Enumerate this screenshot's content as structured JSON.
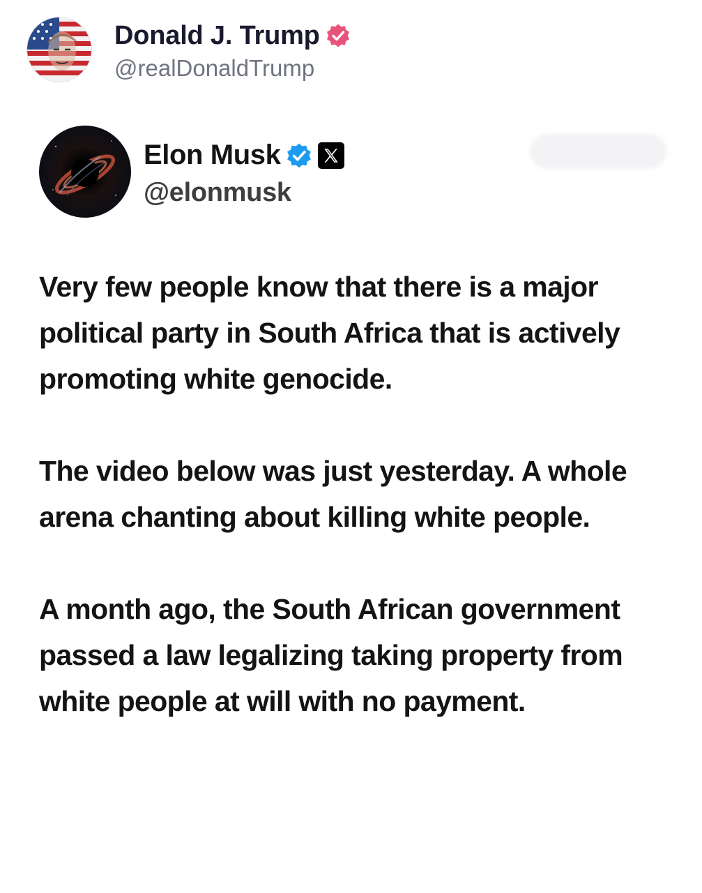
{
  "outer_post": {
    "display_name": "Donald J. Trump",
    "handle": "@realDonaldTrump",
    "verified_icon": "verified-badge-icon",
    "verified_color": "#e8537a"
  },
  "quoted_post": {
    "display_name": "Elon Musk",
    "handle": "@elonmusk",
    "verified_icon": "verified-badge-icon",
    "verified_color": "#1d9bf0",
    "platform_icon": "x-logo-icon",
    "paragraphs": [
      "Very few people know that there is a major political party in South Africa that is actively promoting white genocide.",
      "The video below was just yesterday. A whole arena chanting about killing white people.",
      "A month ago, the South African government passed a law legalizing taking property from white people at will with no payment."
    ]
  }
}
